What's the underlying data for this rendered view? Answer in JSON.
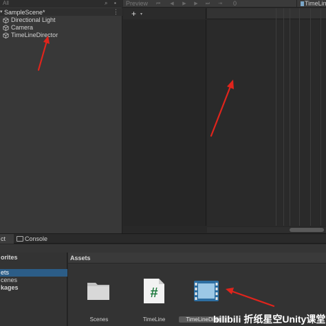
{
  "hierarchy": {
    "search_placeholder": "All",
    "scene_name": "SampleScene*",
    "items": [
      "Directional Light",
      "Camera",
      "TimeLineDirector"
    ]
  },
  "timeline": {
    "preview_label": "Preview",
    "frame_value": "0",
    "asset_label": "TimeLin",
    "add_label": "+",
    "add_caret": "▾"
  },
  "tabs": {
    "project_label": "ct",
    "console_label": "Console"
  },
  "project": {
    "sidebar": {
      "favorites_label": "orites",
      "assets_label": "ets",
      "scenes_label": "cenes",
      "packages_label": "kages"
    },
    "assets_header": "Assets",
    "files": [
      {
        "name": "Scenes",
        "icon": "folder-icon"
      },
      {
        "name": "TimeLine",
        "icon": "csharp-script-icon"
      },
      {
        "name": "TimeLineDirec",
        "icon": "timeline-asset-icon"
      }
    ]
  },
  "watermark": "bilibili 折纸星空Unity课堂",
  "colors": {
    "arrow": "#e0241c",
    "selection": "#2c5d87"
  }
}
